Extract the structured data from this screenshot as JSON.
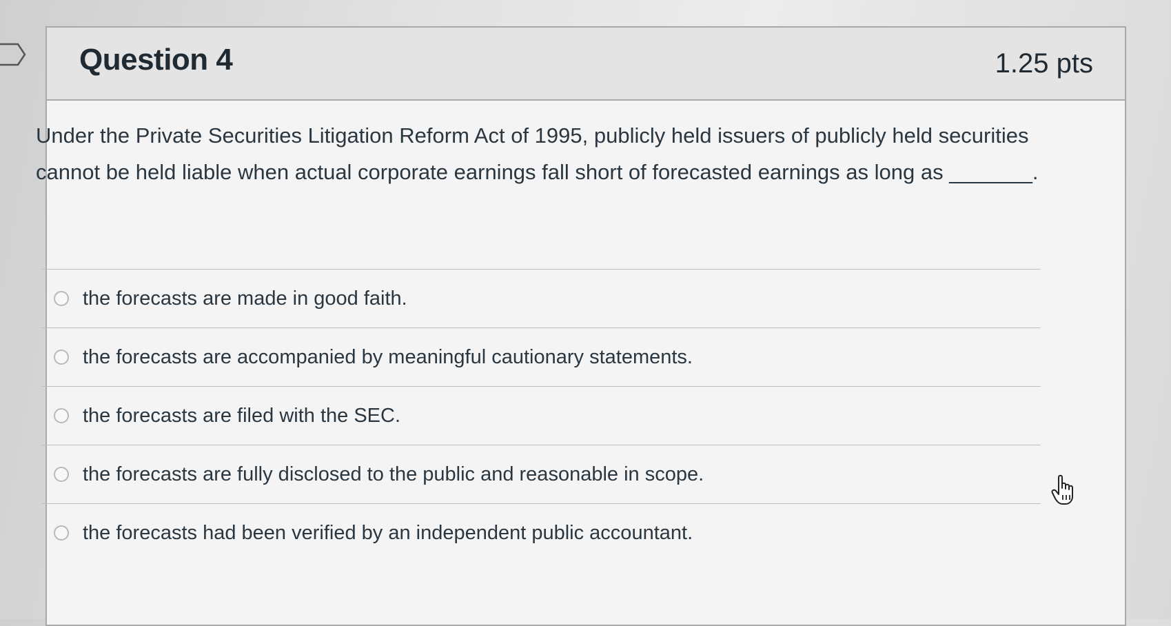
{
  "question": {
    "title": "Question 4",
    "points": "1.25 pts",
    "text": "Under the Private Securities Litigation Reform Act of 1995, publicly held issuers of publicly held securities cannot be held liable when actual corporate earnings fall short of forecasted earnings as long as _______."
  },
  "answers": [
    {
      "label": "the forecasts are made in good faith."
    },
    {
      "label": "the forecasts are accompanied by meaningful cautionary statements."
    },
    {
      "label": "the forecasts are filed with the SEC."
    },
    {
      "label": "the forecasts are fully disclosed to the public and reasonable in scope."
    },
    {
      "label": "the forecasts had been verified by an independent public accountant."
    }
  ],
  "icons": {
    "flag": "flag-question-icon",
    "cursor": "hand-pointer-cursor-icon"
  }
}
